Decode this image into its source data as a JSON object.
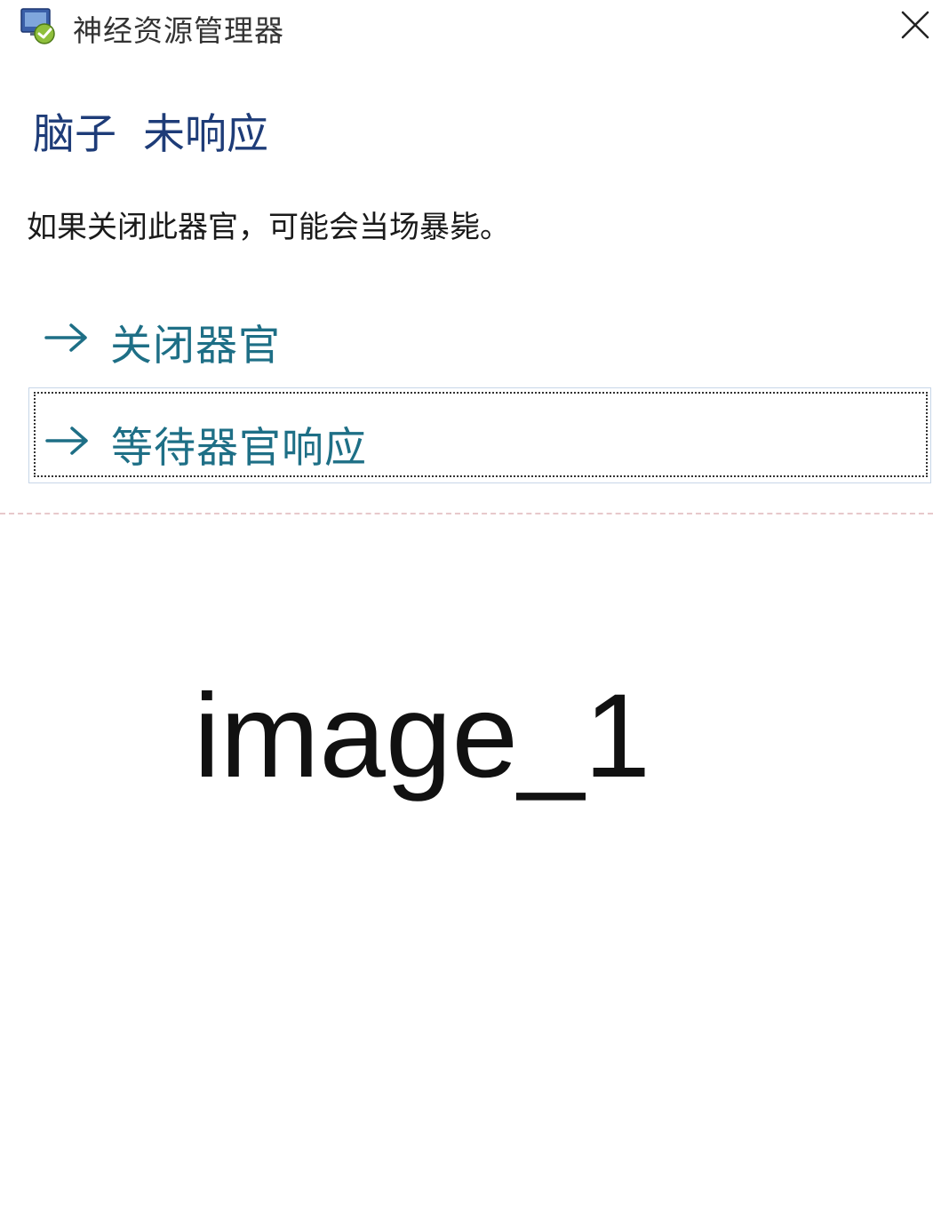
{
  "window": {
    "title": "神经资源管理器",
    "app_icon": "program-not-responding-icon",
    "close_icon": "close-x-icon"
  },
  "dialog": {
    "main_instruction_subject": "脑子",
    "main_instruction_status": "未响应",
    "content": "如果关闭此器官，可能会当场暴毙。",
    "command_links": [
      {
        "label": "关闭器官",
        "icon": "arrow-right-icon"
      },
      {
        "label": "等待器官响应",
        "icon": "arrow-right-icon",
        "focused": true
      }
    ]
  },
  "caption": "image_1",
  "colors": {
    "main_instruction": "#1e3c78",
    "command_link_text": "#1e6f86",
    "body_text": "#1a1a1a",
    "focus_border": "#c7d6e8"
  }
}
